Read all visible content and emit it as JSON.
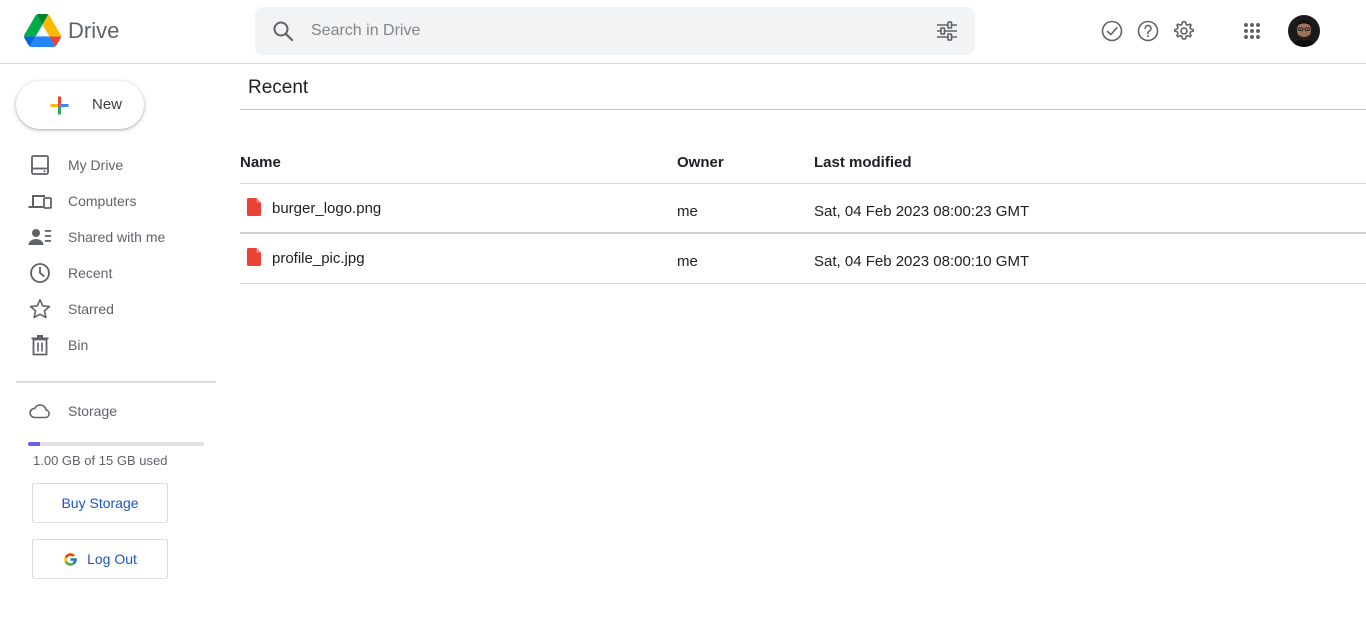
{
  "app": {
    "name": "Drive"
  },
  "search": {
    "placeholder": "Search in Drive",
    "value": ""
  },
  "header_icons": [
    "ready-for-offline-icon",
    "help-icon",
    "settings-icon",
    "apps-grid-icon",
    "avatar"
  ],
  "sidebar": {
    "new_label": "New",
    "items": [
      {
        "label": "My Drive",
        "icon": "drive-icon"
      },
      {
        "label": "Computers",
        "icon": "computers-icon"
      },
      {
        "label": "Shared with me",
        "icon": "people-icon"
      },
      {
        "label": "Recent",
        "icon": "clock-icon"
      },
      {
        "label": "Starred",
        "icon": "star-icon"
      },
      {
        "label": "Bin",
        "icon": "trash-icon"
      }
    ],
    "storage": {
      "label": "Storage",
      "used_text": "1.00 GB of 15 GB used",
      "used_fraction": 0.067,
      "buy_label": "Buy Storage",
      "logout_label": "Log Out"
    }
  },
  "main": {
    "title": "Recent",
    "columns": [
      "Name",
      "Owner",
      "Last modified"
    ],
    "rows": [
      {
        "name": "burger_logo.png",
        "owner": "me",
        "modified": "Sat, 04 Feb 2023 08:00:23 GMT"
      },
      {
        "name": "profile_pic.jpg",
        "owner": "me",
        "modified": "Sat, 04 Feb 2023 08:00:10 GMT"
      }
    ]
  },
  "colors": {
    "accent_blue": "#1a56c4",
    "storage_fill": "#6b63e6",
    "file_icon_red": "#ea4335"
  }
}
